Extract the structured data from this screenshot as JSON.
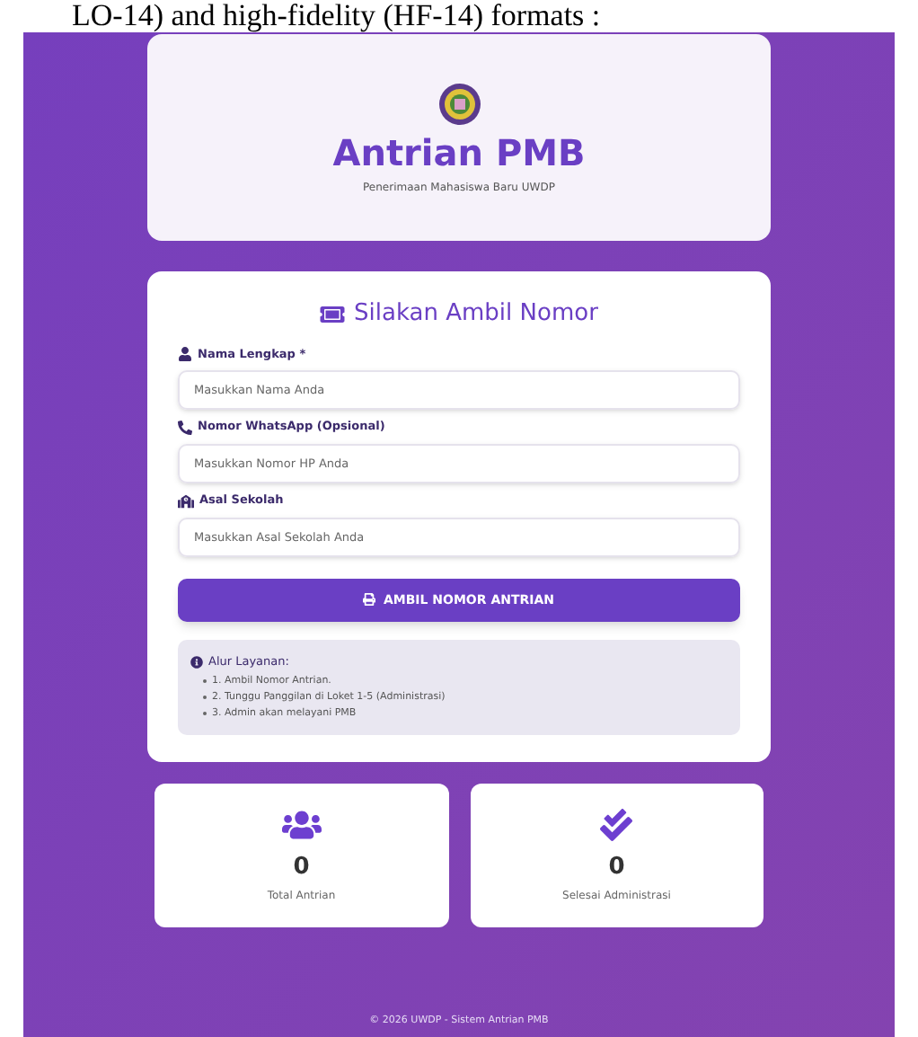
{
  "caption": "LO-14) and high-fidelity (HF-14) formats :",
  "header": {
    "title": "Antrian PMB",
    "subtitle": "Penerimaan Mahasiswa Baru UWDP"
  },
  "form": {
    "title": "Silakan Ambil Nomor",
    "fields": [
      {
        "kind": "person",
        "label": "Nama Lengkap *",
        "placeholder": "Masukkan Nama Anda"
      },
      {
        "kind": "phone",
        "label": "Nomor WhatsApp (Opsional)",
        "placeholder": "Masukkan Nomor HP Anda"
      },
      {
        "kind": "school",
        "label": "Asal Sekolah",
        "placeholder": "Masukkan Asal Sekolah Anda"
      }
    ],
    "button": "AMBIL NOMOR ANTRIAN",
    "info": {
      "title": "Alur Layanan:",
      "steps": [
        "1. Ambil Nomor Antrian.",
        "2. Tunggu Panggilan di Loket 1-5 (Administrasi)",
        "3. Admin akan melayani PMB"
      ]
    }
  },
  "stats": [
    {
      "kind": "users",
      "value": "0",
      "label": "Total Antrian"
    },
    {
      "kind": "done",
      "value": "0",
      "label": "Selesai Administrasi"
    }
  ],
  "footer": "© 2026 UWDP - Sistem Antrian PMB"
}
